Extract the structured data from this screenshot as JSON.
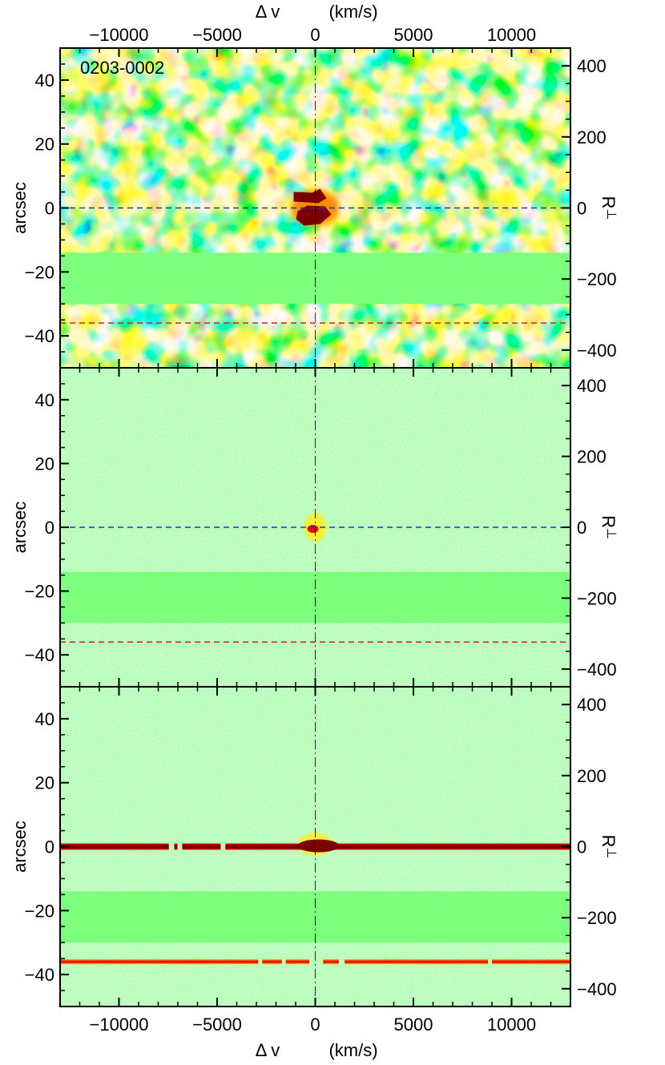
{
  "figure": {
    "panel_label": "0203-0002",
    "top_xlabel": "Δ v",
    "top_xunit": "(km/s)",
    "bottom_xlabel": "Δ v",
    "bottom_xunit": "(km/s)",
    "ylabel": "arcsec",
    "right_ylabel": "R",
    "right_ylabel_sub": "⊥"
  },
  "colors": {
    "background_green": "#7dff7d",
    "cyan": "#1ecbe1",
    "blue": "#1c64d8",
    "yellow": "#ffee22",
    "orange": "#ff8a00",
    "red": "#e01010",
    "darkred": "#7a0000",
    "blue_dashed": "#2233cc",
    "red_dashed": "#cc2222"
  },
  "chart_data": {
    "type": "heatmap",
    "xlim": [
      -13000,
      13000
    ],
    "ylim": [
      -50,
      50
    ],
    "right_ylim": [
      -450,
      450
    ],
    "x_ticks": [
      -10000,
      -5000,
      0,
      5000,
      10000
    ],
    "x_tick_labels": [
      "−10000",
      "−5000",
      "0",
      "5000",
      "10000"
    ],
    "y_ticks": [
      40,
      20,
      0,
      -20,
      -40
    ],
    "y_tick_labels": [
      "40",
      "20",
      "0",
      "−20",
      "−40"
    ],
    "right_ticks": [
      400,
      200,
      0,
      -200,
      -400
    ],
    "right_tick_labels": [
      "400",
      "200",
      "0",
      "−200",
      "−400"
    ],
    "masked_band_arcsec": [
      -30,
      -14
    ],
    "quasar_line_arcsec": 0,
    "second_quasar_line_arcsec": -36,
    "center_velocity": 0,
    "panels": [
      {
        "style": "smoothed",
        "emission_blob": true,
        "continuum_trace": false
      },
      {
        "style": "noise",
        "emission_blob": true,
        "continuum_trace": false
      },
      {
        "style": "noise",
        "emission_blob": false,
        "continuum_trace": true
      }
    ]
  }
}
